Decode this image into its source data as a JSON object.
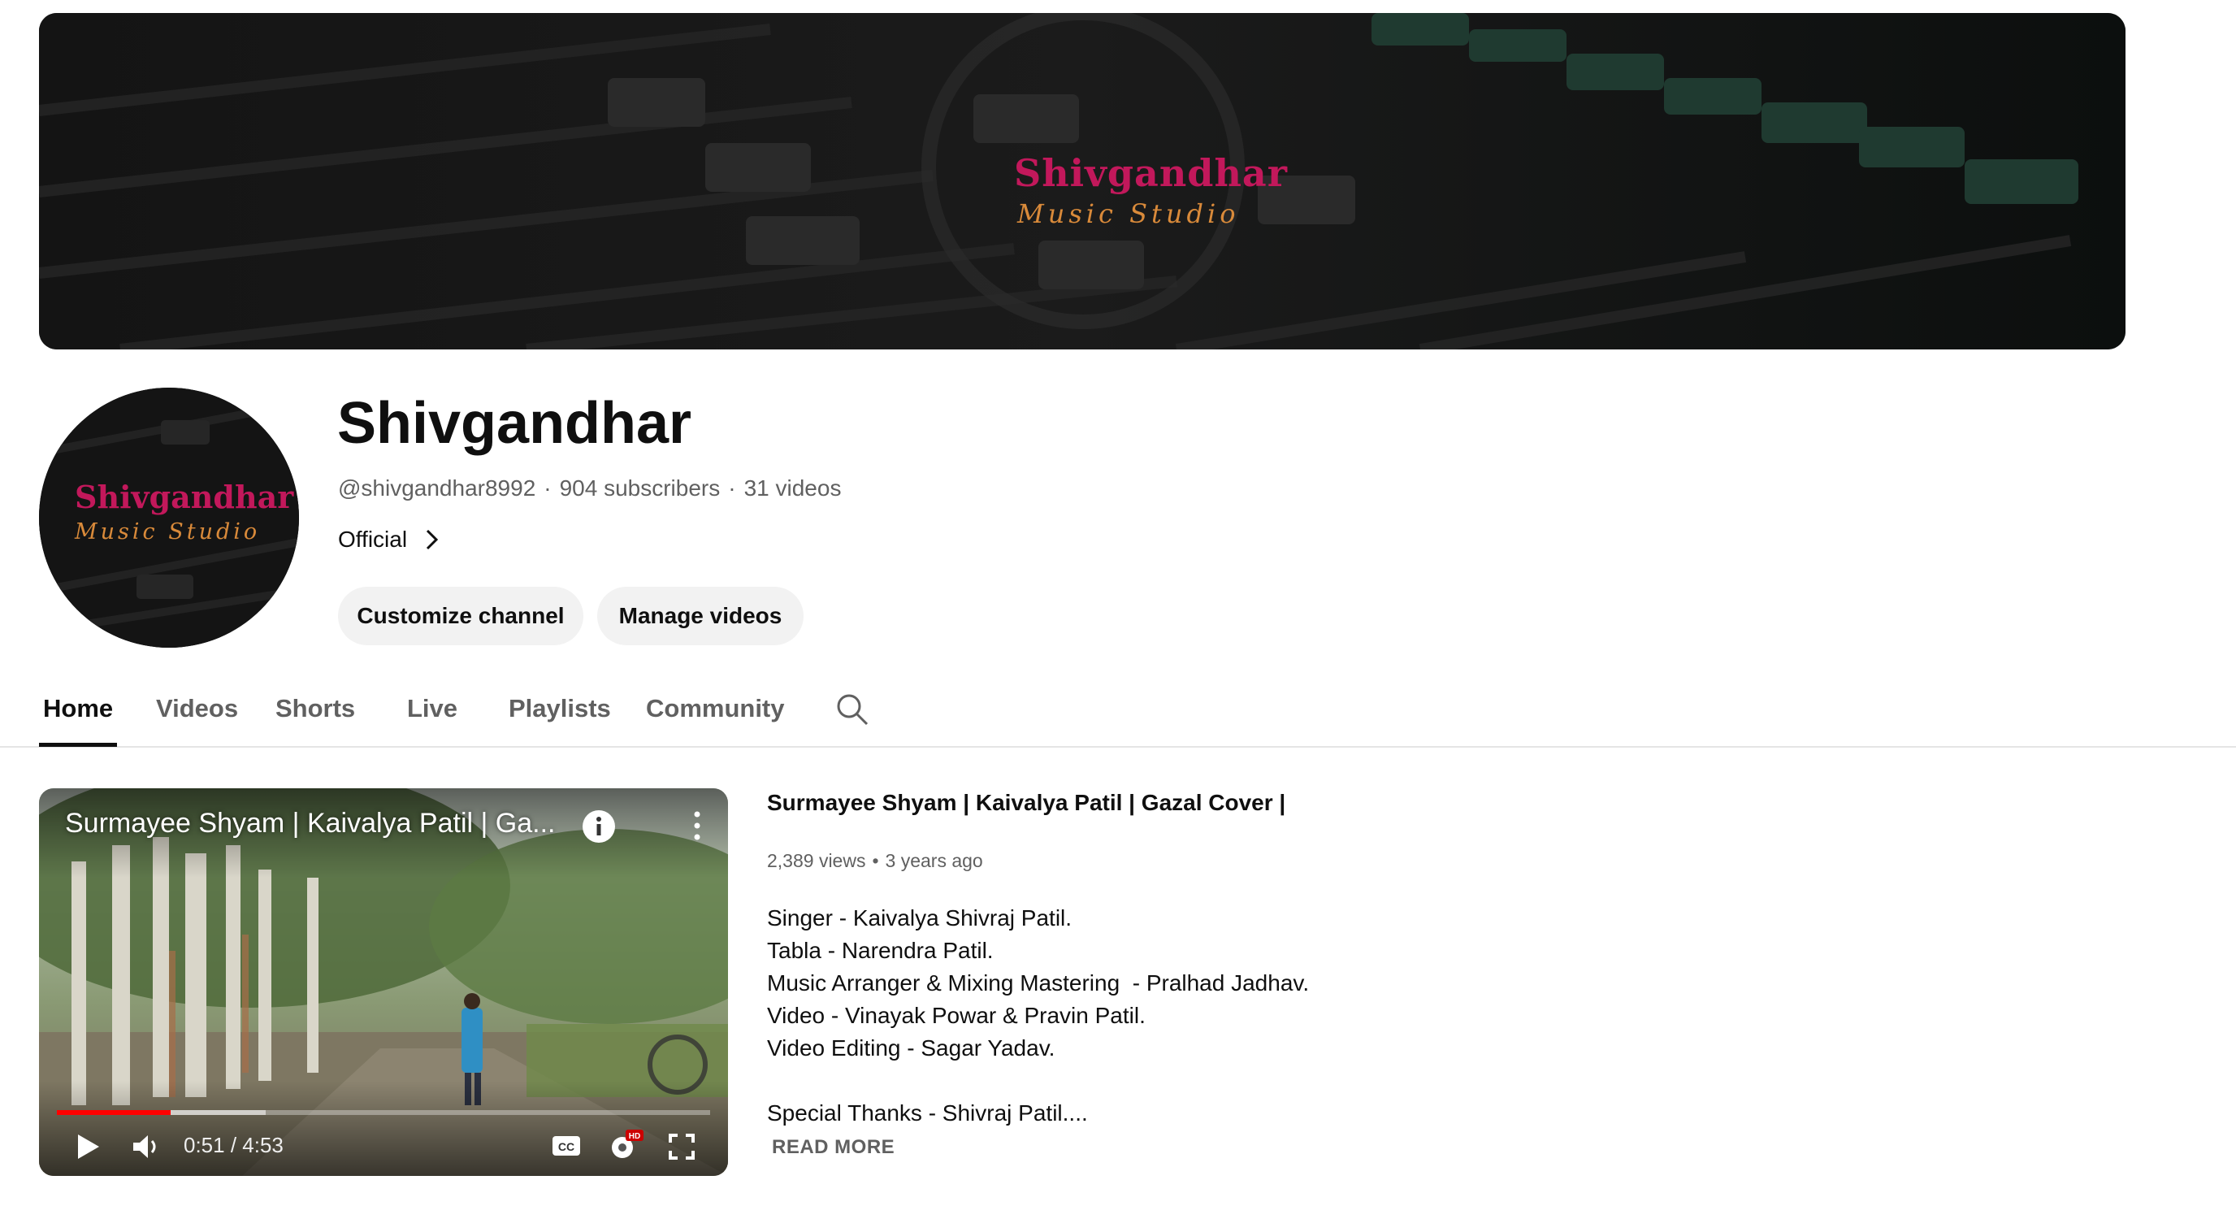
{
  "banner": {
    "logo_line1": "Shivgandhar",
    "logo_line2": "Music Studio"
  },
  "avatar": {
    "logo_line1": "Shivgandhar",
    "logo_line2": "Music Studio"
  },
  "channel": {
    "name": "Shivgandhar",
    "handle": "@shivgandhar8992",
    "subscribers": "904 subscribers",
    "videos": "31 videos",
    "separator": "·",
    "official_label": "Official"
  },
  "actions": {
    "customize_label": "Customize channel",
    "manage_label": "Manage videos"
  },
  "tabs": [
    {
      "label": "Home",
      "active": true
    },
    {
      "label": "Videos",
      "active": false
    },
    {
      "label": "Shorts",
      "active": false
    },
    {
      "label": "Live",
      "active": false
    },
    {
      "label": "Playlists",
      "active": false
    },
    {
      "label": "Community",
      "active": false
    }
  ],
  "player": {
    "overlay_title": "Surmayee Shyam | Kaivalya Patil | Ga...",
    "time": "0:51 / 4:53",
    "progress_played": 0.174,
    "progress_buffered": 0.32,
    "settings_badge": "HD"
  },
  "featured_video": {
    "title": "Surmayee Shyam | Kaivalya Patil | Gazal Cover |",
    "views": "2,389 views",
    "age": "3 years ago",
    "dot": "•",
    "description": "Singer - Kaivalya Shivraj Patil.\nTabla - Narendra Patil.\nMusic Arranger & Mixing Mastering  - Pralhad Jadhav.\nVideo - Vinayak Powar & Pravin Patil.\nVideo Editing - Sagar Yadav.\n\nSpecial Thanks - Shivraj Patil....",
    "read_more": "READ MORE"
  },
  "colors": {
    "accent_red": "#ff0000",
    "text_primary": "#0f0f0f",
    "text_secondary": "#606060",
    "pill_bg": "#f2f2f2",
    "logo_pink": "#c2185b",
    "logo_orange": "#d98a3a"
  }
}
